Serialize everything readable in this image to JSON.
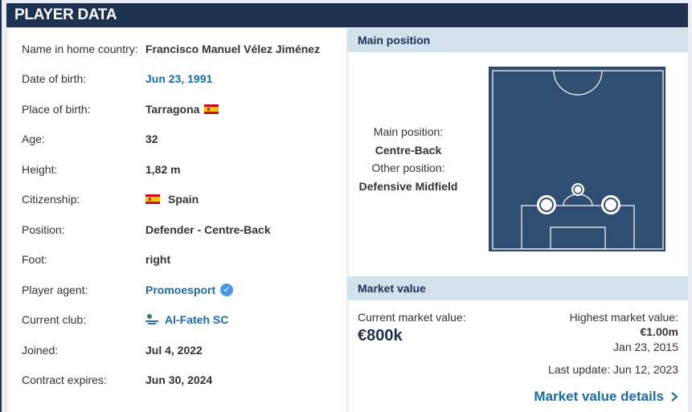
{
  "header": {
    "title": "PLAYER DATA"
  },
  "player_data": {
    "rows": [
      {
        "label": "Name in home country:",
        "value": "Francisco Manuel Vélez Jiménez"
      },
      {
        "label": "Date of birth:",
        "value": "Jun 23, 1991"
      },
      {
        "label": "Place of birth:",
        "value": "Tarragona"
      },
      {
        "label": "Age:",
        "value": "32"
      },
      {
        "label": "Height:",
        "value": "1,82 m"
      },
      {
        "label": "Citizenship:",
        "value": "Spain"
      },
      {
        "label": "Position:",
        "value": "Defender - Centre-Back"
      },
      {
        "label": "Foot:",
        "value": "right"
      },
      {
        "label": "Player agent:",
        "value": "Promoesport"
      },
      {
        "label": "Current club:",
        "value": "Al-Fateh SC"
      },
      {
        "label": "Joined:",
        "value": "Jul 4, 2022"
      },
      {
        "label": "Contract expires:",
        "value": "Jun 30, 2024"
      }
    ]
  },
  "main_position": {
    "heading": "Main position",
    "main_label": "Main position:",
    "main_value": "Centre-Back",
    "other_label": "Other position:",
    "other_value": "Defensive Midfield"
  },
  "market_value": {
    "heading": "Market value",
    "current_label": "Current market value:",
    "current_value": "€800k",
    "highest_label": "Highest market value:",
    "highest_value": "€1.00m",
    "highest_date": "Jan 23, 2015",
    "last_update": "Last update: Jun 12, 2023",
    "details_link": "Market value details"
  },
  "colors": {
    "header_bg": "#1d3150",
    "link": "#1a6aa0",
    "section_head_bg": "#d2e1ec",
    "pitch": "#2f4e72"
  },
  "icons": {
    "birth_flag": "spain-flag-icon",
    "citizenship_flag": "spain-flag-icon",
    "agent_verified": "verified-check-icon",
    "club_logo": "al-fateh-logo-icon",
    "details_chevron": "chevron-right-icon"
  }
}
